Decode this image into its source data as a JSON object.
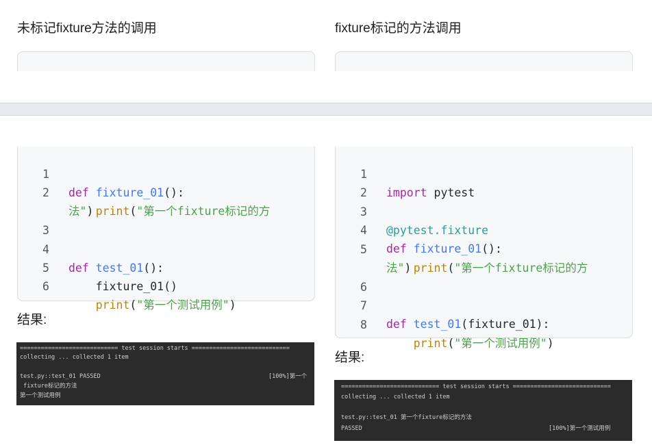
{
  "headings": {
    "left": "未标记fixture方法的调用",
    "right": "fixture标记的方法调用"
  },
  "left_code": {
    "copy_icon": "copy-icon",
    "lines": [
      {
        "n": "1",
        "kw": "def ",
        "fn": "fixture_01",
        "pl": "():"
      },
      {
        "n": "2",
        "indent": "    ",
        "bi": "print",
        "pl1": "(",
        "str": "\"第一个fixture标记的方",
        "cont": "法\"",
        "pl2": ")"
      },
      {
        "n": "3"
      },
      {
        "n": "4",
        "kw": "def ",
        "fn": "test_01",
        "pl": "():"
      },
      {
        "n": "5",
        "text": "    fixture_01()"
      },
      {
        "n": "6",
        "indent": "    ",
        "bi": "print",
        "pl1": "(",
        "str": "\"第一个测试用例\"",
        "pl2": ")"
      }
    ]
  },
  "right_code": {
    "lines": [
      {
        "n": "1",
        "kw": "import",
        "pl": " pytest"
      },
      {
        "n": "2"
      },
      {
        "n": "3",
        "dec": "@pytest.fixture"
      },
      {
        "n": "4",
        "kw": "def ",
        "fn": "fixture_01",
        "pl": "():"
      },
      {
        "n": "5",
        "indent": "    ",
        "bi": "print",
        "pl1": "(",
        "str": "\"第一个fixture标记的方",
        "cont": "法\"",
        "pl2": ")"
      },
      {
        "n": "6"
      },
      {
        "n": "7",
        "kw": "def ",
        "fn": "test_01",
        "pl": "(fixture_01):"
      },
      {
        "n": "8",
        "indent": "    ",
        "bi": "print",
        "pl1": "(",
        "str": "\"第一个测试用例\"",
        "pl2": ")"
      }
    ]
  },
  "result_label": "结果:",
  "terminal_left": {
    "l1": "============================ test session starts ============================",
    "l2": "collecting ... collected 1 item",
    "l3": "test.py::test_01 PASSED",
    "l3r": "[100%]第一个",
    "l4": " fixture标记的方法",
    "l5": "第一个测试用例"
  },
  "terminal_right": {
    "l1": "============================ test session starts ============================",
    "l2": "collecting ... collected 1 item",
    "l3": "test.py::test_01 第一个fixture标记的方法",
    "l4": "PASSED",
    "l4r": "[100%]第一个测试用例"
  }
}
